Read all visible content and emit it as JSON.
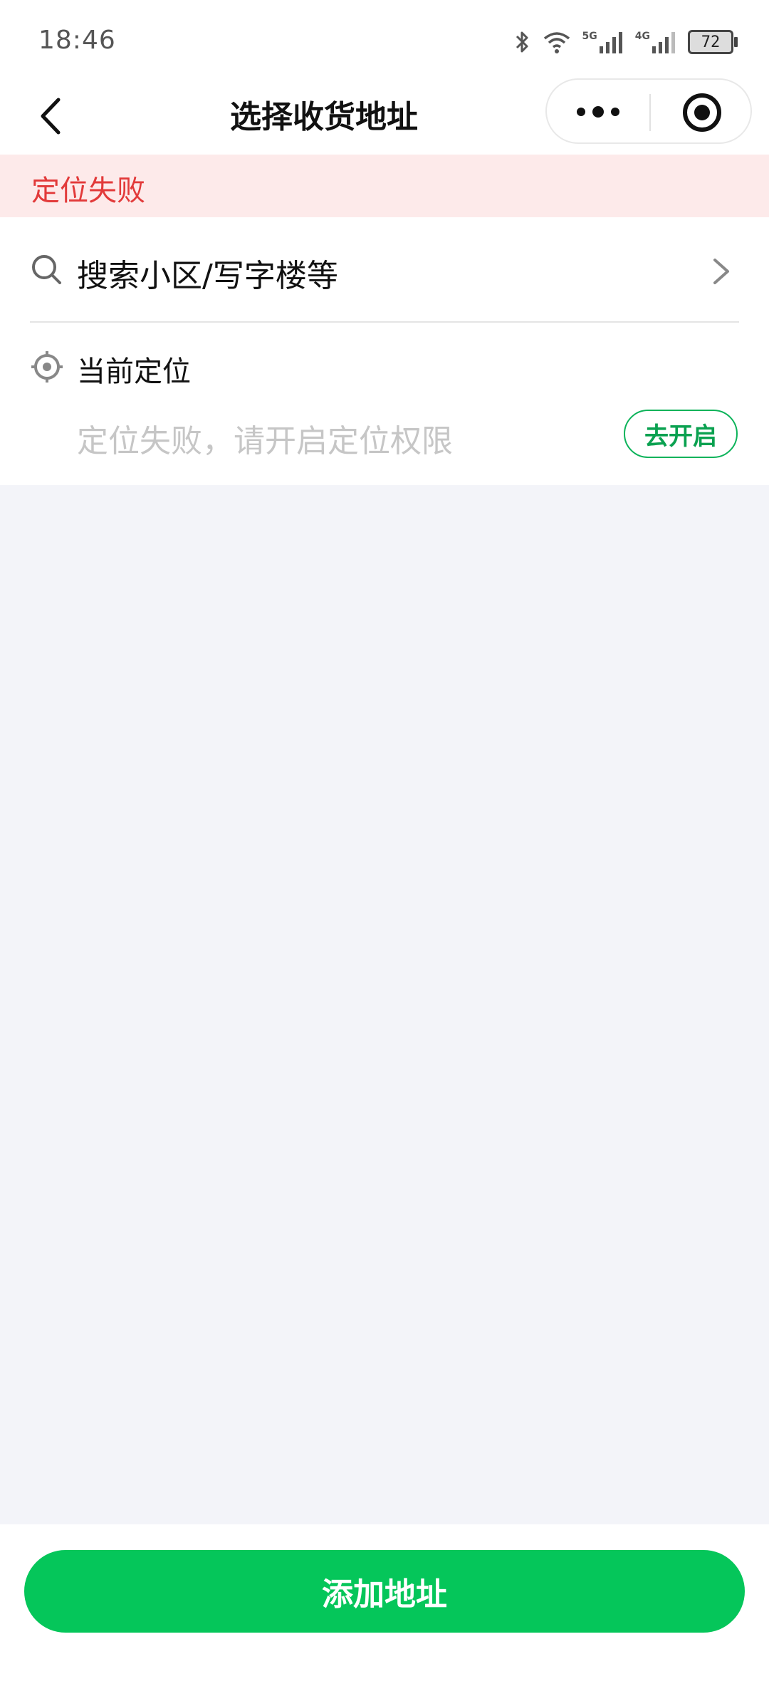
{
  "status_bar": {
    "time": "18:46",
    "network_1": "5G",
    "network_2": "4G",
    "battery": "72"
  },
  "header": {
    "title": "选择收货地址",
    "icons": [
      "back-icon",
      "more-icon",
      "target-icon"
    ]
  },
  "alert": {
    "text": "定位失败",
    "color": "#e23a3a"
  },
  "search": {
    "placeholder": "搜索小区/写字楼等"
  },
  "location": {
    "title": "当前定位",
    "message": "定位失败，请开启定位权限",
    "button_label": "去开启"
  },
  "footer": {
    "add_button_label": "添加地址",
    "accent_color": "#05c65a"
  }
}
